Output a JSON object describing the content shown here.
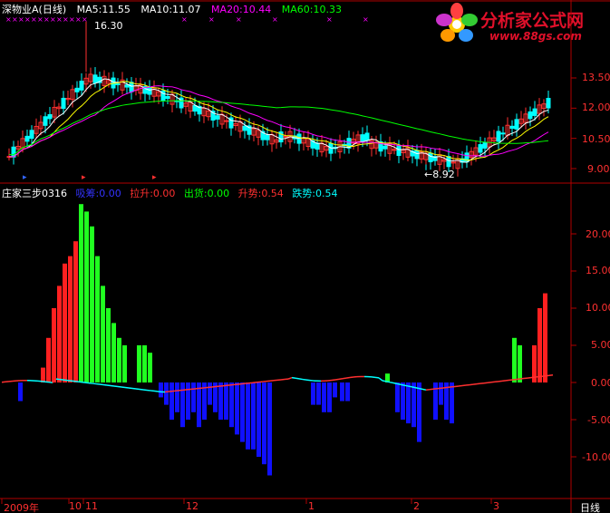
{
  "header": {
    "stock": "深物业A(日线)",
    "ma5": "MA5:11.55",
    "ma10": "MA10:11.07",
    "ma20": "MA20:10.44",
    "ma60": "MA60:10.33"
  },
  "indicator_header": {
    "name": "庄家三步0316",
    "xishou": "吸筹:0.00",
    "lasheng": "拉升:0.00",
    "chuhuo": "出货:0.00",
    "shengshi": "升势:0.54",
    "dieshi": "跌势:0.54"
  },
  "logo": {
    "title": "分析家公式网",
    "url": "www.88gs.com"
  },
  "annotations": {
    "high": "16.30",
    "low": "←8.92"
  },
  "price_axis": [
    "13.50",
    "12.00",
    "10.50",
    "9.00"
  ],
  "ind_axis": [
    "20.00",
    "15.00",
    "10.00",
    "5.00",
    "0.00",
    "-5.00",
    "-10.00"
  ],
  "date_axis": [
    "2009年",
    "10",
    "11",
    "12",
    "1",
    "2",
    "3"
  ],
  "period_label": "日线",
  "colors": {
    "up": "#ff3030",
    "down": "#00ffff",
    "ma5": "#ffffff",
    "ma10": "#ffff00",
    "ma20": "#ff00ff",
    "ma60": "#00ff00",
    "grid": "#8b0000",
    "red_bar": "#ff2020",
    "green_bar": "#20ff20",
    "blue_bar": "#1010ff"
  },
  "chart_data": [
    {
      "type": "candlestick",
      "title": "深物业A(日线)",
      "ylim": [
        8.5,
        17
      ],
      "annotations": {
        "high": 16.3,
        "low": 8.92
      },
      "ma5_label": 11.55,
      "ma10_label": 11.07,
      "ma20_label": 10.44,
      "ma60_label": 10.33
    },
    {
      "type": "bar",
      "title": "庄家三步0316",
      "ylim": [
        -14,
        25
      ],
      "series": [
        {
          "name": "拉升",
          "color": "red",
          "values": [
            0,
            0,
            0,
            0,
            0,
            0,
            0,
            0,
            0,
            0,
            2,
            6,
            10,
            13,
            16,
            17,
            19,
            21,
            22,
            24
          ]
        },
        {
          "name": "吸筹",
          "color": "green",
          "values": [
            25,
            23,
            21,
            17,
            13,
            10,
            8,
            6,
            5,
            5,
            6,
            5,
            4,
            0,
            0,
            0,
            0,
            0,
            0,
            0
          ]
        },
        {
          "name": "出货",
          "color": "blue",
          "values": [
            -1,
            -2,
            -3,
            -4,
            -5,
            -5,
            -6,
            -5,
            -4,
            -3,
            -4,
            -5,
            -6,
            -7,
            -8,
            -9,
            -10,
            -11,
            -12,
            -13
          ]
        }
      ]
    }
  ]
}
